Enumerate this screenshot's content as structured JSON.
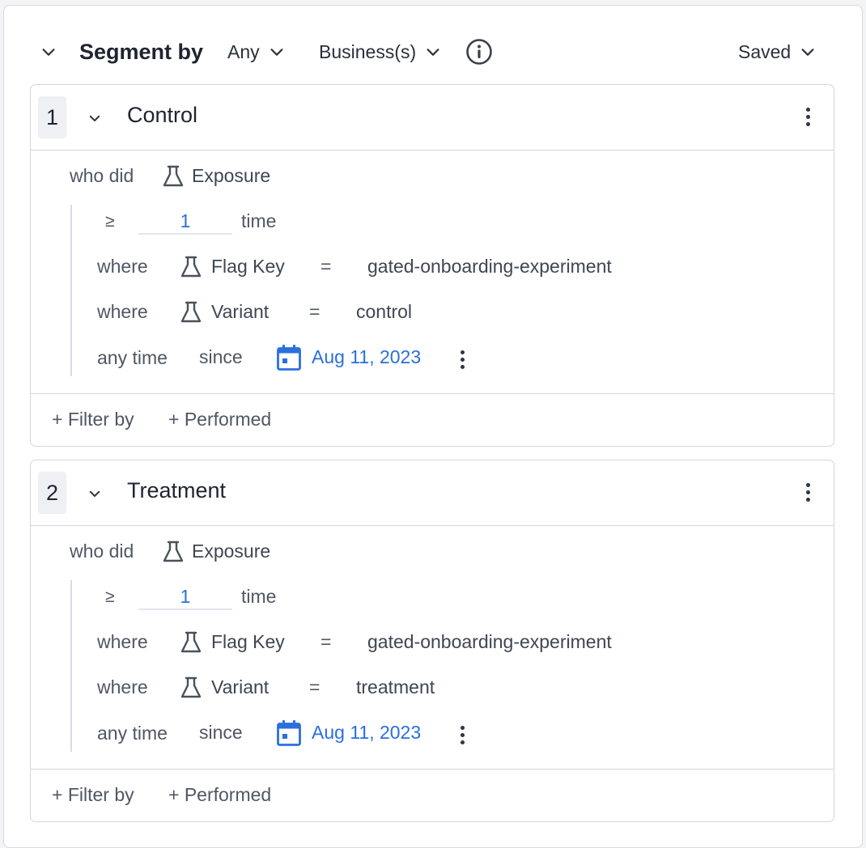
{
  "header": {
    "title": "Segment by",
    "match_any": "Any",
    "entity": "Business(s)",
    "saved": "Saved",
    "collapse_icon": "chevron-down-icon",
    "info_icon": "info-icon"
  },
  "segments": [
    {
      "number": "1",
      "name": "Control",
      "who_did_label": "who did",
      "event": "Exposure",
      "operator_symbol": "≥",
      "count": "1",
      "count_unit": "time",
      "conditions": [
        {
          "where": "where",
          "property": "Flag Key",
          "op": "=",
          "value": "gated-onboarding-experiment"
        },
        {
          "where": "where",
          "property": "Variant",
          "op": "=",
          "value": "control"
        }
      ],
      "time_label": "any time",
      "since_label": "since",
      "date": "Aug 11, 2023",
      "filter_by": "+ Filter by",
      "performed": "+ Performed"
    },
    {
      "number": "2",
      "name": "Treatment",
      "who_did_label": "who did",
      "event": "Exposure",
      "operator_symbol": "≥",
      "count": "1",
      "count_unit": "time",
      "conditions": [
        {
          "where": "where",
          "property": "Flag Key",
          "op": "=",
          "value": "gated-onboarding-experiment"
        },
        {
          "where": "where",
          "property": "Variant",
          "op": "=",
          "value": "treatment"
        }
      ],
      "time_label": "any time",
      "since_label": "since",
      "date": "Aug 11, 2023",
      "filter_by": "+ Filter by",
      "performed": "+ Performed"
    }
  ],
  "colors": {
    "accent": "#2a6fdb",
    "border": "#d3d6dc",
    "text": "#4f5764"
  }
}
